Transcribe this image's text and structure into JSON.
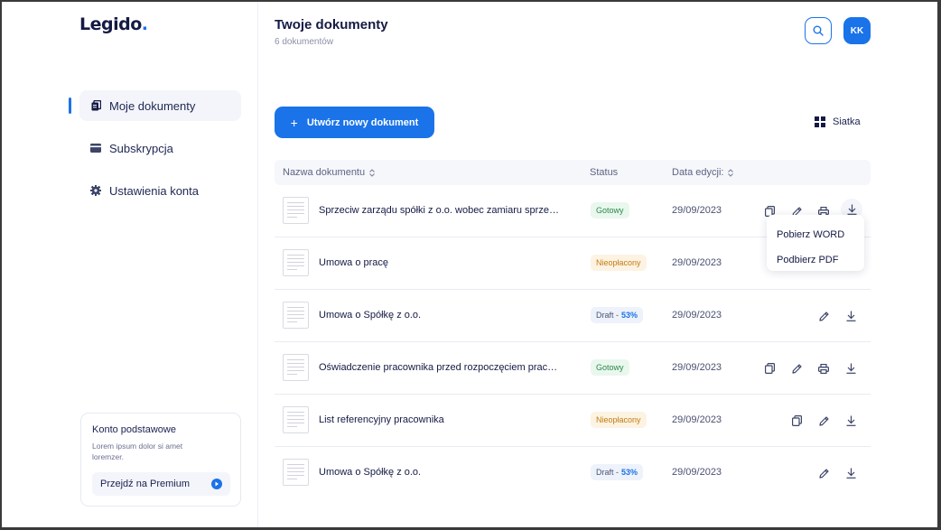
{
  "logo": {
    "text": "Legido",
    "dot": "."
  },
  "sidebar": {
    "items": [
      {
        "label": "Moje dokumenty",
        "icon": "documents-icon",
        "active": true
      },
      {
        "label": "Subskrypcja",
        "icon": "wallet-icon",
        "active": false
      },
      {
        "label": "Ustawienia konta",
        "icon": "gear-icon",
        "active": false
      }
    ],
    "promo": {
      "title": "Konto podstawowe",
      "text": "Lorem ipsum dolor si amet loremzer.",
      "button": "Przejdź na Premium"
    }
  },
  "header": {
    "title": "Twoje dokumenty",
    "subtitle": "6 dokumentów",
    "avatar": "KK"
  },
  "toolbar": {
    "create_label": "Utwórz nowy dokument",
    "view_label": "Siatka"
  },
  "table": {
    "columns": [
      "Nazwa dokumentu",
      "Status",
      "Data edycji:"
    ],
    "rows": [
      {
        "name": "Sprzeciw zarządu spółki z o.o. wobec zamiaru sprze…",
        "status": "Gotowy",
        "status_type": "ready",
        "date": "29/09/2023"
      },
      {
        "name": "Umowa o pracę",
        "status": "Nieopłacony",
        "status_type": "unpaid",
        "date": "29/09/2023"
      },
      {
        "name": "Umowa o Spółkę z o.o.",
        "status": "Draft -",
        "status_pct": "53%",
        "status_type": "draft",
        "date": "29/09/2023"
      },
      {
        "name": "Oświadczenie pracownika przed rozpoczęciem prac…",
        "status": "Gotowy",
        "status_type": "ready",
        "date": "29/09/2023"
      },
      {
        "name": "List referencyjny pracownika",
        "status": "Nieopłacony",
        "status_type": "unpaid",
        "date": "29/09/2023"
      },
      {
        "name": "Umowa o Spółkę z o.o.",
        "status": "Draft -",
        "status_pct": "53%",
        "status_type": "draft",
        "date": "29/09/2023"
      }
    ]
  },
  "download_menu": {
    "items": [
      "Pobierz WORD",
      "Podbierz PDF"
    ]
  },
  "colors": {
    "accent": "#1a73e8",
    "text": "#141a44",
    "ready": "#2a8a48",
    "unpaid": "#c27c12"
  }
}
